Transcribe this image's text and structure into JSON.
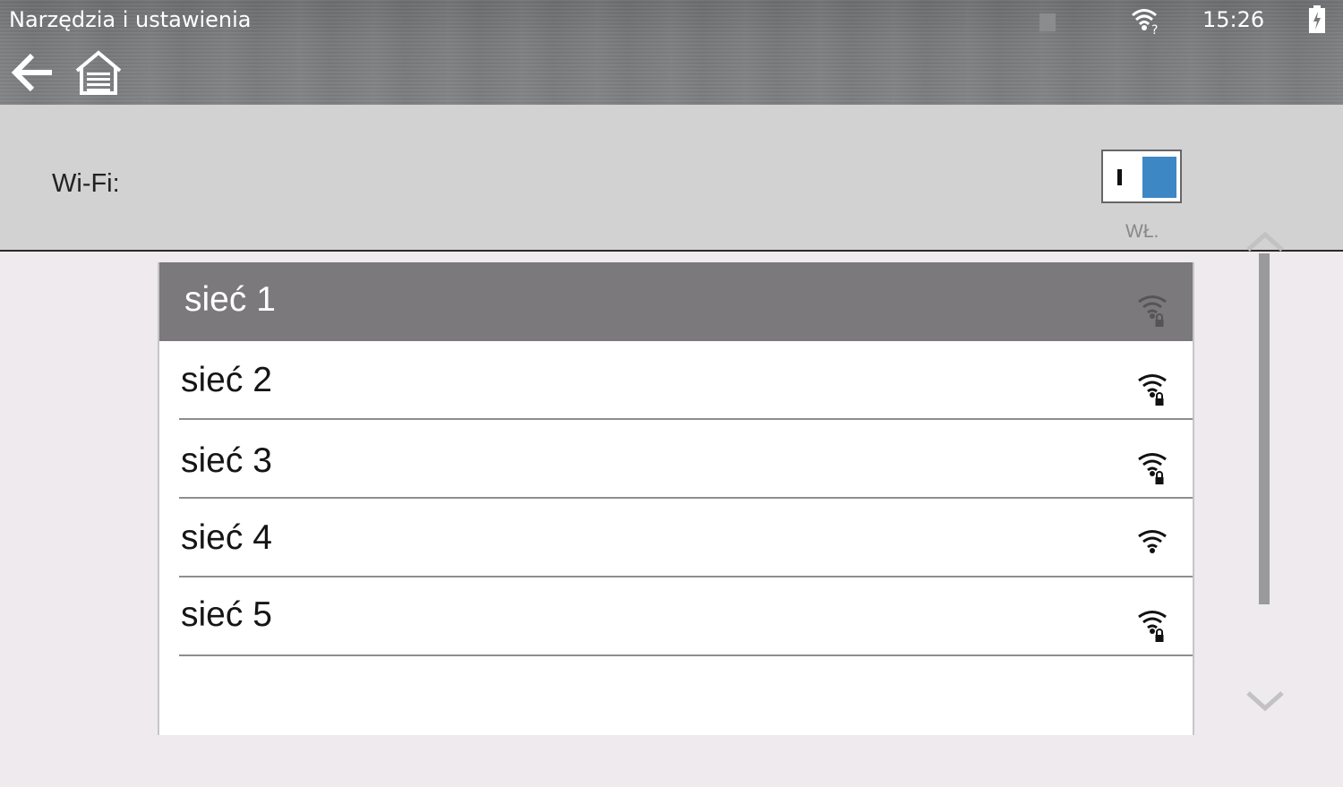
{
  "status_bar": {
    "title": "Narzędzia i ustawienia",
    "time": "15:26",
    "wifi_icon": "wifi-unknown-icon",
    "battery_icon": "battery-charging-icon"
  },
  "toolbar": {
    "back_icon": "back-arrow-icon",
    "home_icon": "garage-home-icon"
  },
  "wifi": {
    "label": "Wi-Fi:",
    "toggle_state": "WŁ.",
    "enabled": true,
    "toggle_color": "#3d87c5"
  },
  "networks": [
    {
      "name": "sieć 1",
      "secured": true,
      "selected": true
    },
    {
      "name": "sieć 2",
      "secured": true,
      "selected": false
    },
    {
      "name": "sieć 3",
      "secured": true,
      "selected": false
    },
    {
      "name": "sieć 4",
      "secured": false,
      "selected": false
    },
    {
      "name": "sieć 5",
      "secured": true,
      "selected": false
    }
  ],
  "colors": {
    "selected_row": "#7b797c",
    "panel": "#d2d2d2",
    "background": "#eeeaee"
  }
}
